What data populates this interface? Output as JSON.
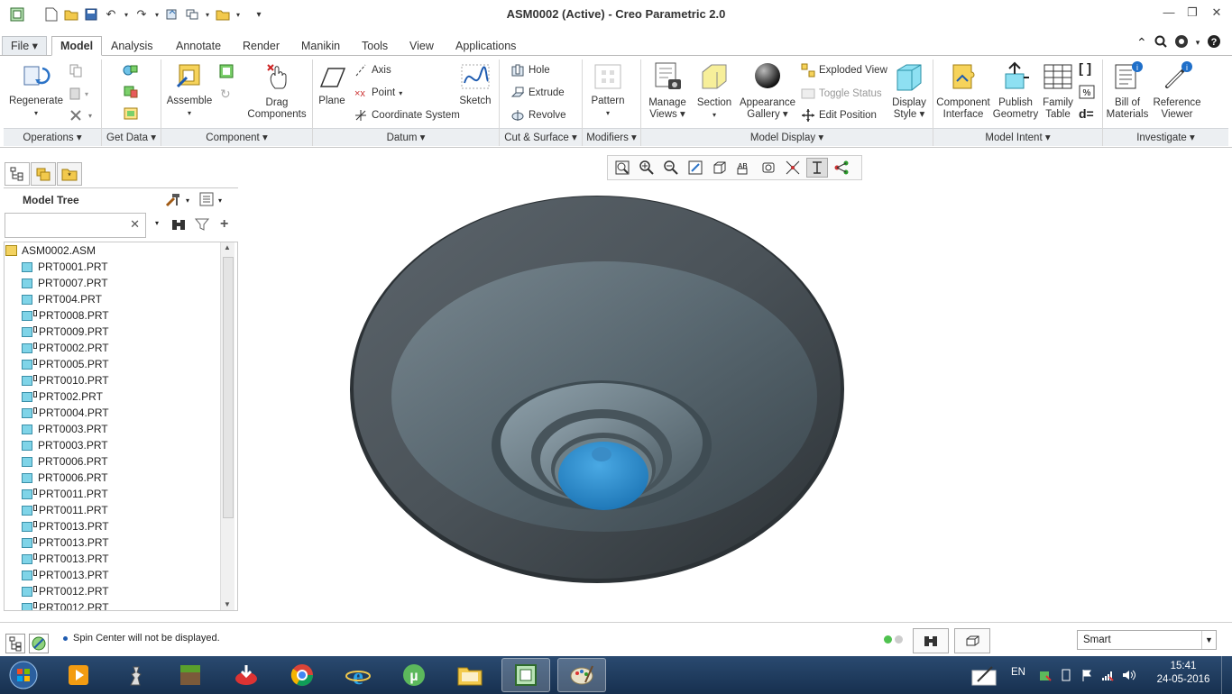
{
  "window": {
    "title": "ASM0002 (Active) - Creo Parametric 2.0"
  },
  "tabs": [
    {
      "label": "File",
      "active": false
    },
    {
      "label": "Model",
      "active": true
    },
    {
      "label": "Analysis",
      "active": false
    },
    {
      "label": "Annotate",
      "active": false
    },
    {
      "label": "Render",
      "active": false
    },
    {
      "label": "Manikin",
      "active": false
    },
    {
      "label": "Tools",
      "active": false
    },
    {
      "label": "View",
      "active": false
    },
    {
      "label": "Applications",
      "active": false
    }
  ],
  "ribbon": {
    "operations": {
      "label": "Operations",
      "regenerate": "Regenerate"
    },
    "get_data": {
      "label": "Get Data"
    },
    "component": {
      "label": "Component",
      "assemble": "Assemble",
      "drag_1": "Drag",
      "drag_2": "Components"
    },
    "datum": {
      "label": "Datum",
      "plane": "Plane",
      "axis": "Axis",
      "point": "Point",
      "csys": "Coordinate System",
      "sketch": "Sketch"
    },
    "cut_surface": {
      "label": "Cut & Surface",
      "hole": "Hole",
      "extrude": "Extrude",
      "revolve": "Revolve"
    },
    "modifiers": {
      "label": "Modifiers",
      "pattern": "Pattern"
    },
    "model_display": {
      "label": "Model Display",
      "manage_1": "Manage",
      "manage_2": "Views",
      "section": "Section",
      "appearance_1": "Appearance",
      "appearance_2": "Gallery",
      "exploded": "Exploded View",
      "toggle": "Toggle Status",
      "edit_position": "Edit Position",
      "display_1": "Display",
      "display_2": "Style"
    },
    "model_intent": {
      "label": "Model Intent",
      "comp_1": "Component",
      "comp_2": "Interface",
      "publish_1": "Publish",
      "publish_2": "Geometry",
      "family_1": "Family",
      "family_2": "Table"
    },
    "investigate": {
      "label": "Investigate",
      "bom_1": "Bill of",
      "bom_2": "Materials",
      "ref_1": "Reference",
      "ref_2": "Viewer"
    }
  },
  "model_tree": {
    "title": "Model Tree",
    "search_value": "",
    "root": "ASM0002.ASM",
    "items": [
      "PRT0001.PRT",
      "PRT0007.PRT",
      "PRT004.PRT",
      "PRT0008.PRT",
      "PRT0009.PRT",
      "PRT0002.PRT",
      "PRT0005.PRT",
      "PRT0010.PRT",
      "PRT002.PRT",
      "PRT0004.PRT",
      "PRT0003.PRT",
      "PRT0003.PRT",
      "PRT0006.PRT",
      "PRT0006.PRT",
      "PRT0011.PRT",
      "PRT0011.PRT",
      "PRT0013.PRT",
      "PRT0013.PRT",
      "PRT0013.PRT",
      "PRT0013.PRT",
      "PRT0012.PRT",
      "PRT0012.PRT"
    ]
  },
  "status": {
    "message": "Spin Center will not be displayed.",
    "filter": "Smart"
  },
  "taskbar": {
    "lang": "EN",
    "time": "15:41",
    "date": "24-05-2016"
  },
  "colors": {
    "accent": "#2d7fc1",
    "model_dark": "#4a5258",
    "model_light": "#8c9aa2",
    "core": "#2f93d4"
  }
}
